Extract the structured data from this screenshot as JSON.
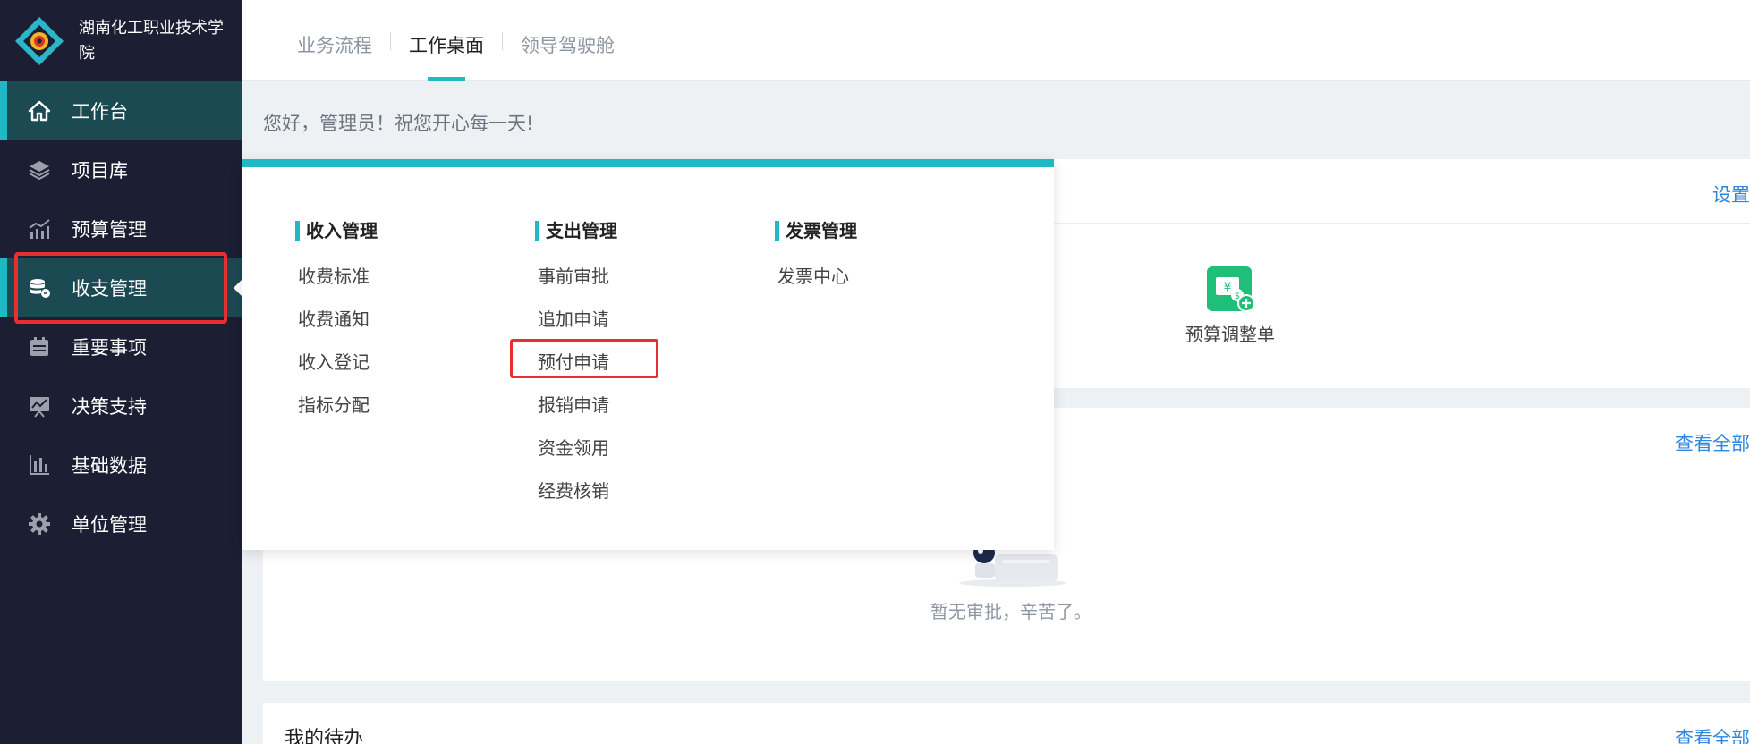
{
  "brand": {
    "name": "湖南化工职业技术学院"
  },
  "sidebar": {
    "items": [
      {
        "label": "工作台",
        "icon": "home-icon"
      },
      {
        "label": "项目库",
        "icon": "layers-icon"
      },
      {
        "label": "预算管理",
        "icon": "chart-icon"
      },
      {
        "label": "收支管理",
        "icon": "coins-icon"
      },
      {
        "label": "重要事项",
        "icon": "calendar-icon"
      },
      {
        "label": "决策支持",
        "icon": "trend-board-icon"
      },
      {
        "label": "基础数据",
        "icon": "bar-chart-icon"
      },
      {
        "label": "单位管理",
        "icon": "gear-icon"
      }
    ]
  },
  "header": {
    "tabs": [
      {
        "label": "业务流程"
      },
      {
        "label": "工作桌面"
      },
      {
        "label": "领导驾驶舱"
      }
    ]
  },
  "greeting": "您好，管理员！祝您开心每一天!",
  "card1": {
    "link": "设置",
    "quick_item": "预算调整单"
  },
  "card2": {
    "link": "查看全部",
    "empty_text": "暂无审批，辛苦了。"
  },
  "card3": {
    "title": "我的待办",
    "link": "查看全部"
  },
  "dropdown": {
    "columns": [
      {
        "title": "收入管理",
        "items": [
          "收费标准",
          "收费通知",
          "收入登记",
          "指标分配"
        ]
      },
      {
        "title": "支出管理",
        "items": [
          "事前审批",
          "追加申请",
          "预付申请",
          "报销申请",
          "资金领用",
          "经费核销"
        ]
      },
      {
        "title": "发票管理",
        "items": [
          "发票中心"
        ]
      }
    ]
  },
  "colors": {
    "accent": "#20b8c4",
    "sidebar_bg": "#1c1f33",
    "link": "#2f86e0",
    "highlight": "#e62f2f",
    "quick_icon": "#1fbf7a"
  }
}
